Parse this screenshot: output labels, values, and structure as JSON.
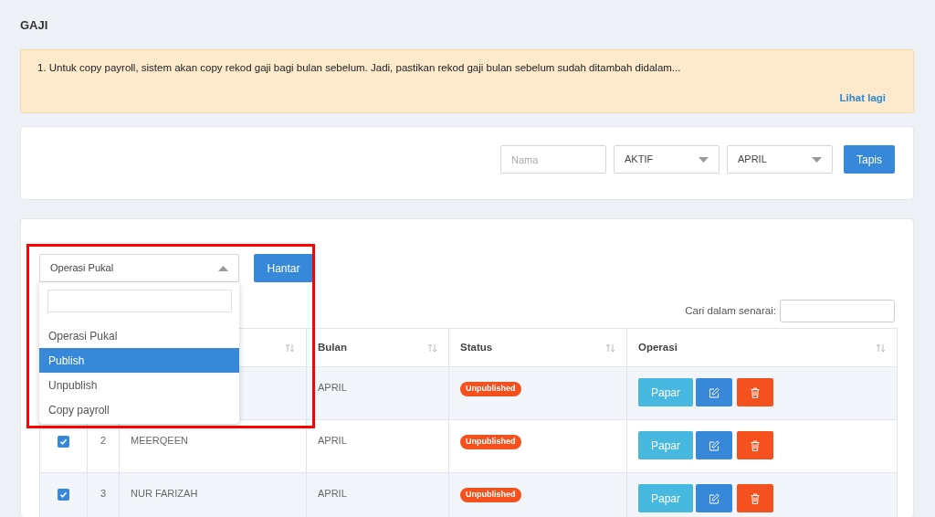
{
  "page_title": "GAJI",
  "notice": {
    "text": "1. Untuk copy payroll, sistem akan copy rekod gaji bagi bulan sebelum. Jadi, pastikan rekod gaji bulan sebelum sudah ditambah didalam...",
    "link": "Lihat lagi"
  },
  "filter": {
    "name_field": {
      "placeholder": "Nama"
    },
    "status_select": "AKTIF",
    "month_select": "APRIL",
    "button": "Tapis"
  },
  "bulk_action": {
    "select": {
      "value": "Operasi Pukal",
      "expanded": true
    },
    "options": [
      {
        "label": "Operasi Pukal",
        "selected": false
      },
      {
        "label": "Publish",
        "selected": true
      },
      {
        "label": "Unpublish",
        "selected": false
      },
      {
        "label": "Copy payroll",
        "selected": false
      }
    ],
    "button": "Hantar"
  },
  "search": {
    "label": "Cari dalam senarai:"
  },
  "table": {
    "columns": [
      "Bulan",
      "Status",
      "Operasi"
    ],
    "rows": [
      {
        "month": "APRIL",
        "status": "Unpublished",
        "view_button": "Papar"
      },
      {
        "checked": true,
        "number": "2",
        "name": "MEERQEEN",
        "month": "APRIL",
        "status": "Unpublished",
        "view_button": "Papar"
      },
      {
        "checked": true,
        "number": "3",
        "name": "NUR FARIZAH",
        "month": "APRIL",
        "status": "Unpublished",
        "view_button": "Papar"
      }
    ]
  }
}
